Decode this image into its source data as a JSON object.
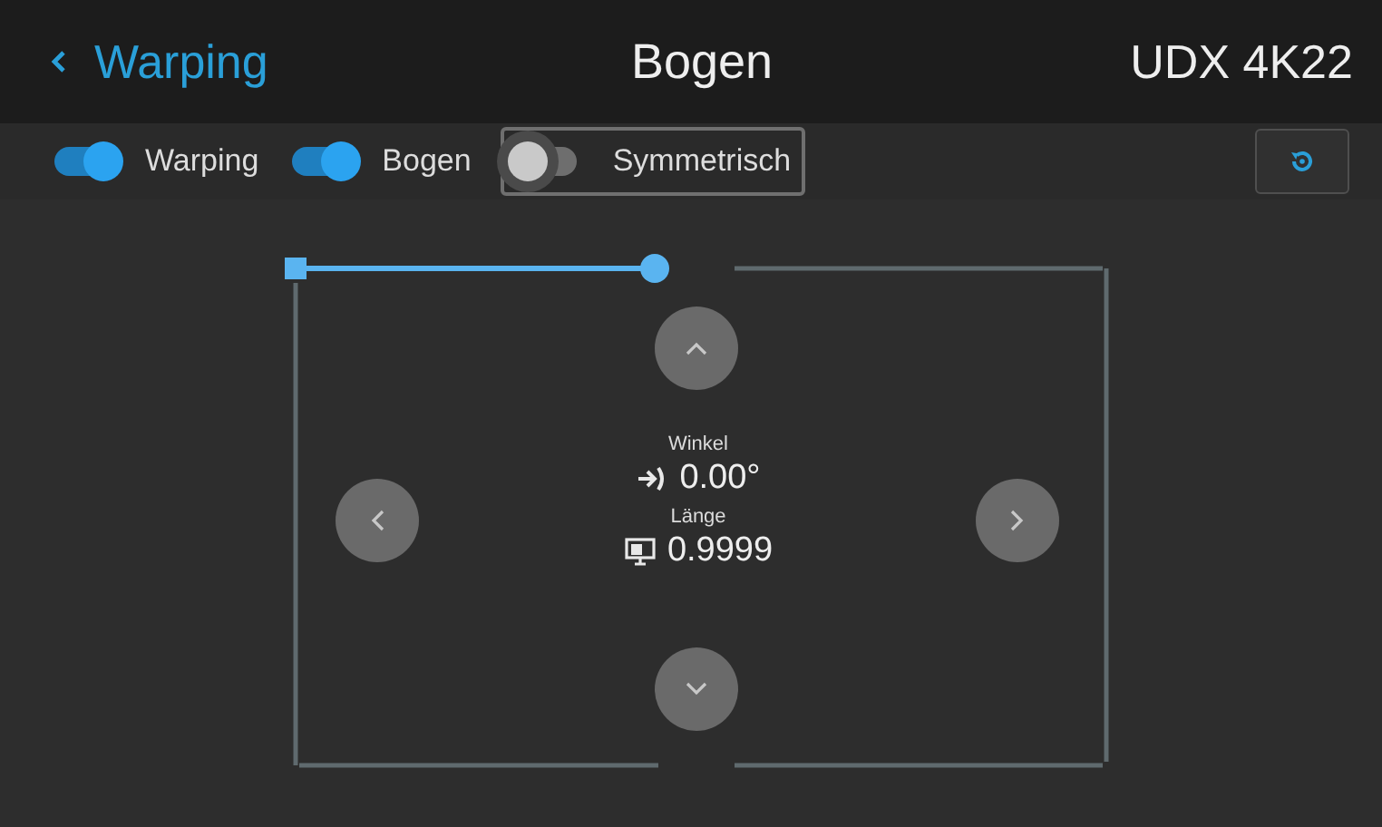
{
  "header": {
    "back_label": "Warping",
    "title": "Bogen",
    "device": "UDX 4K22"
  },
  "toggles": [
    {
      "label": "Warping",
      "on": true,
      "focused": false
    },
    {
      "label": "Bogen",
      "on": true,
      "focused": false
    },
    {
      "label": "Symmetrisch",
      "on": false,
      "focused": true
    }
  ],
  "edges": [
    {
      "kind": "topleft",
      "selected": true
    },
    {
      "kind": "topright",
      "selected": false
    },
    {
      "kind": "right",
      "selected": false
    },
    {
      "kind": "bottomright",
      "selected": false
    },
    {
      "kind": "bottomleft",
      "selected": false
    },
    {
      "kind": "left",
      "selected": false
    }
  ],
  "readouts": [
    {
      "kind": "angle",
      "label": "Winkel",
      "value": "0.00°"
    },
    {
      "kind": "length",
      "label": "Länge",
      "value": "0.9999"
    }
  ]
}
